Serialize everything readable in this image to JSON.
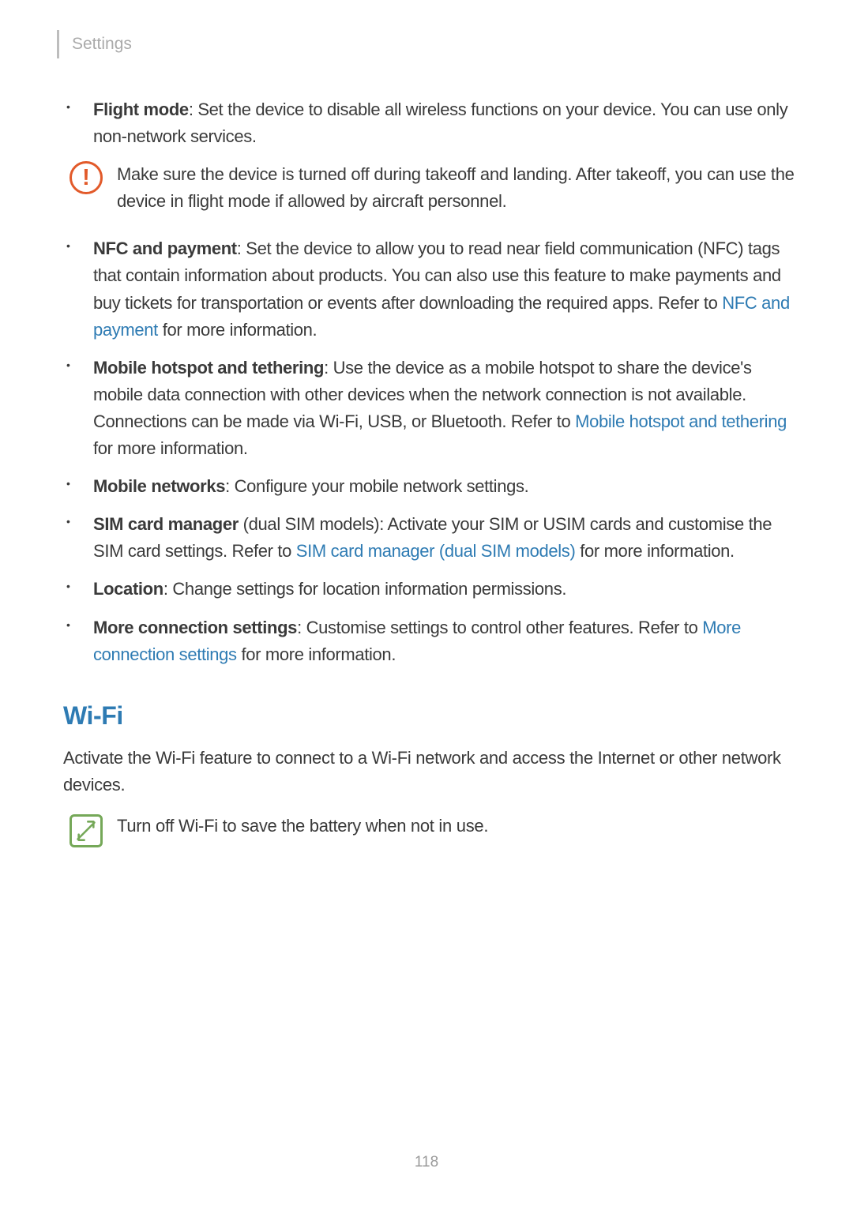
{
  "header": {
    "title": "Settings"
  },
  "items": {
    "flightMode": {
      "term": "Flight mode",
      "desc": ": Set the device to disable all wireless functions on your device. You can use only non-network services."
    },
    "warningCallout": "Make sure the device is turned off during takeoff and landing. After takeoff, you can use the device in flight mode if allowed by aircraft personnel.",
    "nfc": {
      "term": "NFC and payment",
      "descPre": ": Set the device to allow you to read near field communication (NFC) tags that contain information about products. You can also use this feature to make payments and buy tickets for transportation or events after downloading the required apps. Refer to ",
      "link": "NFC and payment",
      "descPost": " for more information."
    },
    "hotspot": {
      "term": "Mobile hotspot and tethering",
      "descPre": ": Use the device as a mobile hotspot to share the device's mobile data connection with other devices when the network connection is not available. Connections can be made via Wi-Fi, USB, or Bluetooth. Refer to ",
      "link": "Mobile hotspot and tethering",
      "descPost": " for more information."
    },
    "mobileNetworks": {
      "term": "Mobile networks",
      "desc": ": Configure your mobile network settings."
    },
    "sim": {
      "term": "SIM card manager",
      "descPre": " (dual SIM models): Activate your SIM or USIM cards and customise the SIM card settings. Refer to ",
      "link": "SIM card manager (dual SIM models)",
      "descPost": " for more information."
    },
    "location": {
      "term": "Location",
      "desc": ": Change settings for location information permissions."
    },
    "more": {
      "term": "More connection settings",
      "descPre": ": Customise settings to control other features. Refer to ",
      "link": "More connection settings",
      "descPost": " for more information."
    }
  },
  "wifi": {
    "heading": "Wi-Fi",
    "intro": "Activate the Wi-Fi feature to connect to a Wi-Fi network and access the Internet or other network devices.",
    "noteCallout": "Turn off Wi-Fi to save the battery when not in use."
  },
  "pageNumber": "118",
  "icons": {
    "warning": "!"
  }
}
